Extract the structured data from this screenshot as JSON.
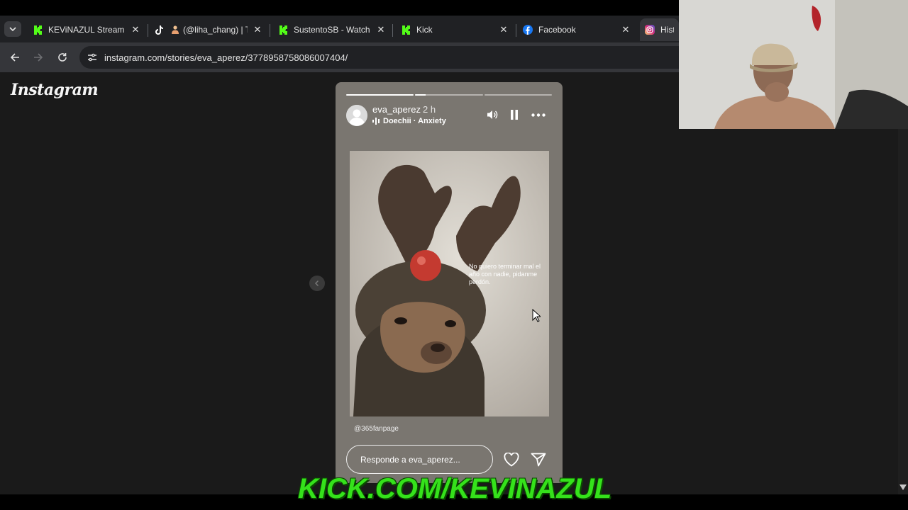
{
  "browser": {
    "tabs": [
      {
        "title": "KEViNAZUL Stream -",
        "icon": "kick-icon",
        "active": false
      },
      {
        "title": "(@liha_chang) | T",
        "icon": "tiktok-icon",
        "active": false
      },
      {
        "title": "SustentoSB - Watch",
        "icon": "kick-icon",
        "active": false
      },
      {
        "title": "Kick",
        "icon": "kick-icon",
        "active": false
      },
      {
        "title": "Facebook",
        "icon": "facebook-icon",
        "active": false
      },
      {
        "title": "Histo",
        "icon": "instagram-icon",
        "active": true
      }
    ],
    "close_glyph": "✕",
    "url": "instagram.com/stories/eva_aperez/3778958758086007404/"
  },
  "page": {
    "logo": "Instagram"
  },
  "story": {
    "username": "eva_aperez",
    "time_ago": "2 h",
    "music": "Doechii · Anxiety",
    "progress": [
      1.0,
      0.15,
      0.0
    ],
    "image_text": "No quiero terminar mal el año con nadie, pidanme perdón.",
    "credit": "@365fanpage",
    "reply_placeholder": "Responde a eva_aperez..."
  },
  "overlay": {
    "banner": "KICK.COM/KEVINAZUL"
  },
  "colors": {
    "kick_green": "#53fc18",
    "facebook_blue": "#1877f2",
    "banner_green": "#35e21b"
  }
}
